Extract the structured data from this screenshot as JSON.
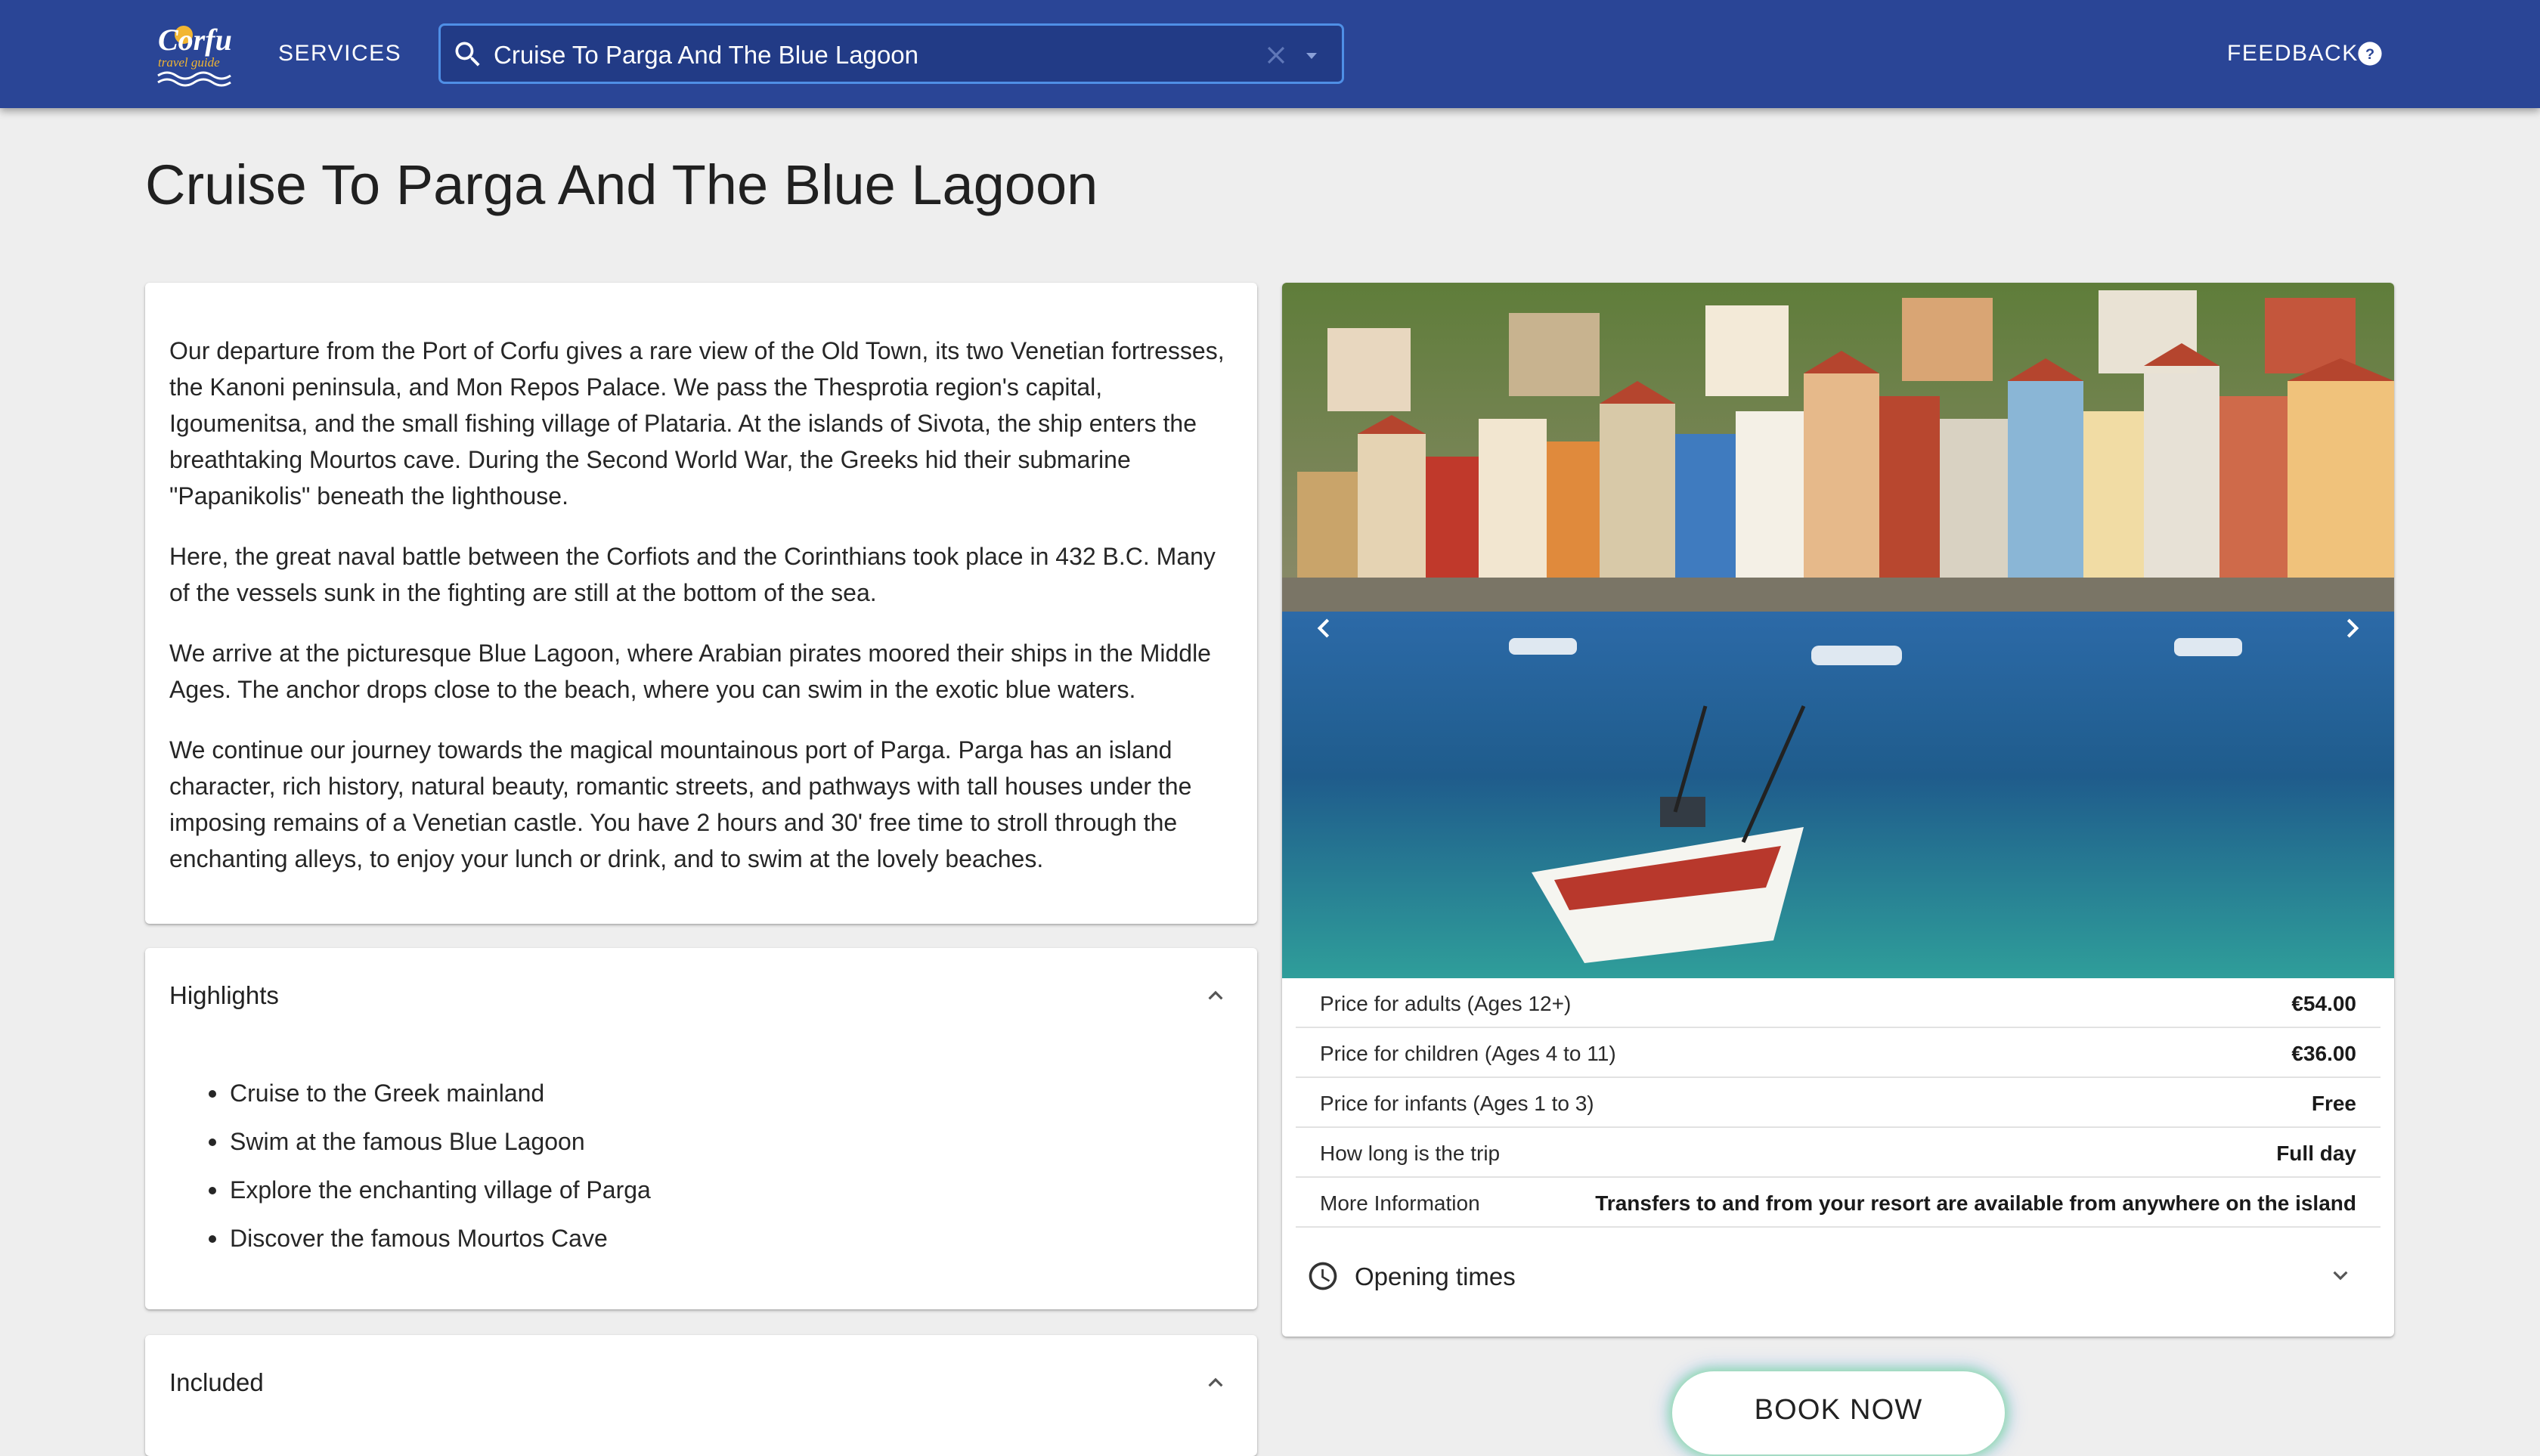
{
  "header": {
    "logo": {
      "line1": "Corfu",
      "line2": "travel guide"
    },
    "services_label": "SERVICES",
    "search": {
      "value": "Cruise To Parga And The Blue Lagoon"
    },
    "feedback_label": "FEEDBACK"
  },
  "page": {
    "title": "Cruise To Parga And The Blue Lagoon",
    "description": [
      "Our departure from the Port of Corfu gives a rare view of the Old Town, its two Venetian fortresses, the Kanoni peninsula, and Mon Repos Palace. We pass the Thesprotia region's capital, Igoumenitsa, and the small fishing village of Plataria. At the islands of Sivota, the ship enters the breathtaking Mourtos cave. During the Second World War, the Greeks hid their submarine \"Papanikolis\" beneath the lighthouse.",
      "Here, the great naval battle between the Corfiots and the Corinthians took place in 432 B.C. Many of the vessels sunk in the fighting are still at the bottom of the sea.",
      "We arrive at the picturesque Blue Lagoon, where Arabian pirates moored their ships in the Middle Ages. The anchor drops close to the beach, where you can swim in the exotic blue waters.",
      "We continue our journey towards the magical mountainous port of Parga. Parga has an island character, rich history, natural beauty, romantic streets, and pathways with tall houses under the imposing remains of a Venetian castle. You have 2 hours and 30' free time to stroll through the enchanting alleys, to enjoy your lunch or drink, and to swim at the lovely beaches."
    ],
    "highlights": {
      "title": "Highlights",
      "items": [
        "Cruise to the Greek mainland",
        "Swim at the famous Blue Lagoon",
        "Explore the enchanting village of Parga",
        "Discover the famous Mourtos Cave"
      ]
    },
    "included": {
      "title": "Included"
    },
    "prices": [
      {
        "label": "Price for adults (Ages 12+)",
        "value": "€54.00"
      },
      {
        "label": "Price for children (Ages 4 to 11)",
        "value": "€36.00"
      },
      {
        "label": "Price for infants (Ages 1 to 3)",
        "value": "Free"
      },
      {
        "label": "How long is the trip",
        "value": "Full day"
      },
      {
        "label": "More Information",
        "value": "Transfers to and from your resort are available from anywhere on the island"
      }
    ],
    "opening_times_label": "Opening times",
    "book_now_label": "BOOK NOW"
  },
  "icons": [
    "search-icon",
    "close-icon",
    "arrow-drop-down-icon",
    "help-icon",
    "chevron-up-icon",
    "chevron-left-icon",
    "chevron-right-icon",
    "clock-icon",
    "chevron-down-icon"
  ],
  "colors": {
    "appbar": "#2a4596",
    "search_border": "#4f8fe6",
    "background": "#eeeeee"
  }
}
